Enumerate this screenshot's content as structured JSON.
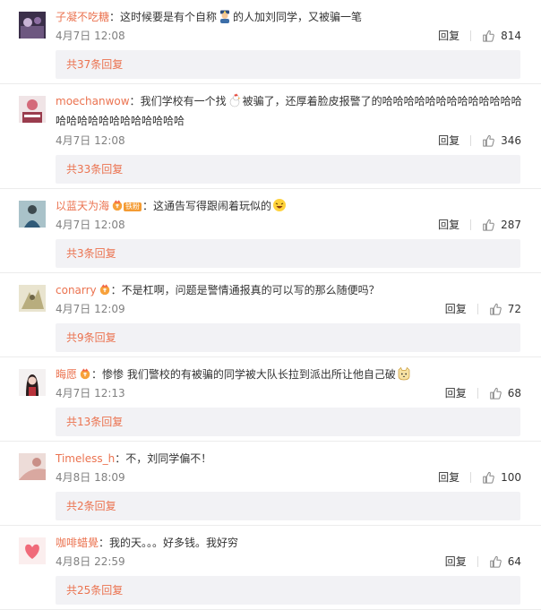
{
  "labels": {
    "reply": "回复"
  },
  "colors": {
    "name": "#eb7350",
    "link": "#eb7350",
    "time": "#808080",
    "more_bg": "#f2f2f5"
  },
  "comments": [
    {
      "name": "子凝不吃糖",
      "sep": "：",
      "text_a": "这时候要是有个自称",
      "emoji_a": "police-officer-emoji",
      "text_b": "的人加刘同学，又被骗一笔",
      "time": "4月7日 12:08",
      "likes": "814",
      "more": "共37条回复"
    },
    {
      "name": "moechanwow",
      "sep": "：",
      "text_a": "我们学校有一个找",
      "emoji_a": "chicken-emoji",
      "text_b": "被骗了，还厚着脸皮报警了的哈哈哈哈哈哈哈哈哈哈哈哈哈哈哈哈哈哈哈哈哈哈哈哈哈",
      "time": "4月7日 12:08",
      "likes": "346",
      "more": "共33条回复"
    },
    {
      "name": "以蓝天为海",
      "badge": "铁粉",
      "sep": "：",
      "text_a": "这通告写得跟闹着玩似的",
      "emoji_a": "laughing-emoji",
      "text_b": "",
      "time": "4月7日 12:08",
      "likes": "287",
      "more": "共3条回复"
    },
    {
      "name": "conarry",
      "sep": "：",
      "text_a": "不是杠啊，问题是警情通报真的可以写的那么随便吗？",
      "time": "4月7日 12:09",
      "likes": "72",
      "more": "共9条回复"
    },
    {
      "name": "晦愿",
      "sep": "：",
      "text_a": "惨惨 我们警校的有被骗的同学被大队长拉到派出所让他自己破",
      "emoji_a": "cat-emoji",
      "text_b": "",
      "time": "4月7日 12:13",
      "likes": "68",
      "more": "共13条回复"
    },
    {
      "name": "Timeless_h",
      "sep": "：",
      "text_a": "不，刘同学偏不！",
      "time": "4月8日 18:09",
      "likes": "100",
      "more": "共2条回复"
    },
    {
      "name": "咖啡蜡覺",
      "sep": "：",
      "text_a": "我的天。。。好多钱。我好穷",
      "time": "4月8日 22:59",
      "likes": "64",
      "more": "共25条回复"
    }
  ]
}
